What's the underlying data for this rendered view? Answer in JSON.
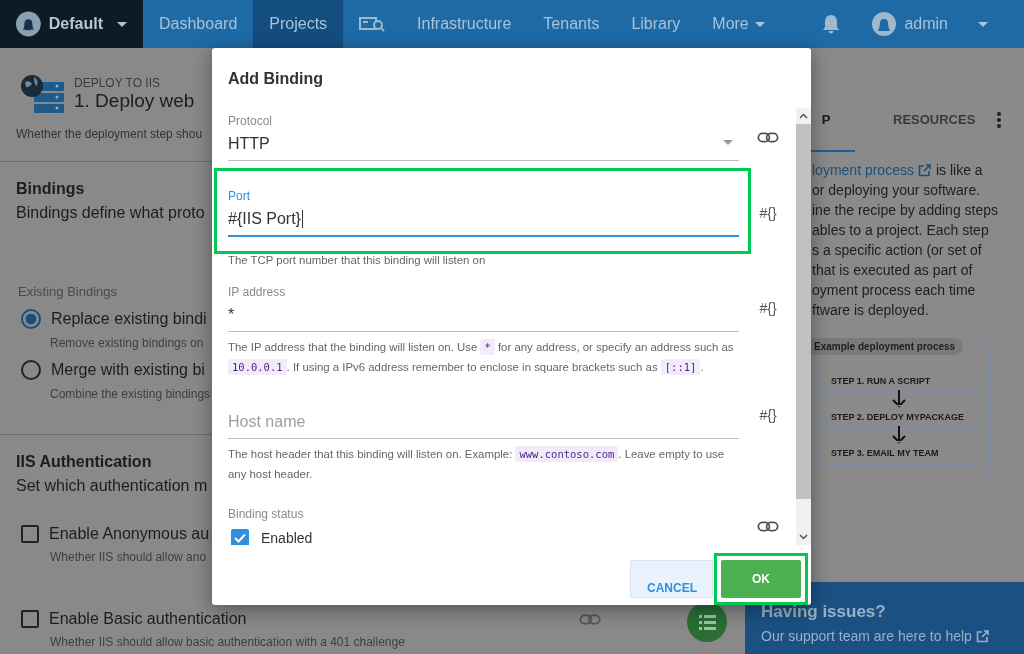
{
  "nav": {
    "space": "Default",
    "items": [
      {
        "label": "Dashboard",
        "selected": false,
        "kind": "text"
      },
      {
        "label": "Projects",
        "selected": true,
        "kind": "text"
      },
      {
        "selected": false,
        "kind": "icon"
      },
      {
        "label": "Infrastructure",
        "selected": false,
        "kind": "text"
      },
      {
        "label": "Tenants",
        "selected": false,
        "kind": "text"
      },
      {
        "label": "Library",
        "selected": false,
        "kind": "text"
      },
      {
        "label": "More",
        "selected": false,
        "kind": "menu"
      }
    ],
    "user": "admin"
  },
  "page": {
    "breadcrumb": "DEPLOY TO IIS",
    "title": "1.  Deploy web",
    "description": "Whether the deployment step shou",
    "bindings": {
      "title": "Bindings",
      "description": "Bindings define what proto",
      "group_label": "Existing Bindings",
      "options": [
        {
          "label": "Replace existing bindi",
          "hint": "Remove existing bindings on",
          "selected": true
        },
        {
          "label": "Merge with existing bi",
          "hint": "Combine the existing bindings",
          "selected": false
        }
      ]
    },
    "auth": {
      "title": "IIS Authentication",
      "description": "Set which authentication m",
      "options": [
        {
          "label": "Enable Anonymous au",
          "hint": "Whether IIS should allow ano",
          "checked": false,
          "linked": false
        },
        {
          "label": "Enable Basic authentication",
          "hint": "Whether IIS should allow basic authentication with a 401 challenge",
          "checked": false,
          "linked": true
        }
      ]
    }
  },
  "sidebar": {
    "tabs": [
      {
        "label": "P",
        "selected": true
      },
      {
        "label": "RESOURCES",
        "selected": false
      }
    ],
    "lines": [
      {
        "text": "loyment process",
        "link": true,
        "after": "is like a"
      },
      {
        "text": "or deploying your software.",
        "link": false
      },
      {
        "text": "ine the recipe by adding steps",
        "link": false
      },
      {
        "text": "ables to a project. Each step",
        "link": false
      },
      {
        "text": "s a specific action (or set of",
        "link": false
      },
      {
        "text": "that is executed as part of",
        "link": false
      },
      {
        "text": "oyment process each time",
        "link": false
      },
      {
        "text": "ftware is deployed.",
        "link": false
      }
    ],
    "diagram": {
      "title": "Example deployment process",
      "steps": [
        "STEP 1. RUN A SCRIPT",
        "STEP 2. DEPLOY MYPACKAGE",
        "STEP 3. EMAIL MY TEAM"
      ]
    },
    "support": {
      "title": "Having issues?",
      "text": "Our support team are here to help"
    }
  },
  "modal": {
    "title": "Add Binding",
    "fields": [
      {
        "kind": "select",
        "label": "Protocol",
        "value": "HTTP",
        "action": {
          "kind": "link"
        },
        "focused": false,
        "highlighted": false
      },
      {
        "kind": "text",
        "label": "Port",
        "value": "#{IIS Port}",
        "hint": [
          {
            "text": "The TCP port number that this binding will listen on"
          }
        ],
        "action": {
          "kind": "variable",
          "text": "#{}"
        },
        "focused": true,
        "highlighted": true
      },
      {
        "kind": "text",
        "label": "IP address",
        "value": "*",
        "hint": [
          {
            "text": "The IP address that the binding will listen on. Use "
          },
          {
            "code": "*"
          },
          {
            "text": " for any address, or specify an address such as "
          },
          {
            "code": "10.0.0.1"
          },
          {
            "text": ". If using a IPv6 address remember to enclose in square brackets such as "
          },
          {
            "code": "[::1]"
          },
          {
            "text": "."
          }
        ],
        "action": {
          "kind": "variable",
          "text": "#{}"
        },
        "focused": false,
        "highlighted": false
      },
      {
        "kind": "text",
        "placeholder": "Host name",
        "hint": [
          {
            "text": "The host header that this binding will listen on. Example: "
          },
          {
            "code": "www.contoso.com"
          },
          {
            "text": ". Leave empty to use any host header."
          }
        ],
        "action": {
          "kind": "variable",
          "text": "#{}"
        },
        "focused": false,
        "highlighted": false
      },
      {
        "kind": "checkbox",
        "label": "Binding status",
        "option": "Enabled",
        "checked": true,
        "action": {
          "kind": "link"
        },
        "highlighted": false
      }
    ],
    "buttons": [
      {
        "label": "CANCEL",
        "kind": "secondary",
        "highlighted": false
      },
      {
        "label": "OK",
        "kind": "primary",
        "highlighted": true
      }
    ]
  }
}
